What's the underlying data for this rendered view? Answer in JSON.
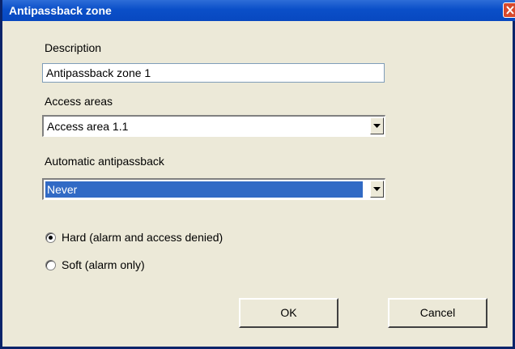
{
  "window": {
    "title": "Antipassback zone"
  },
  "description": {
    "label": "Description",
    "value": "Antipassback zone 1"
  },
  "access_areas": {
    "label": "Access areas",
    "selected": "Access area 1.1"
  },
  "automatic_antipassback": {
    "label": "Automatic antipassback",
    "selected": "Never"
  },
  "mode": {
    "options": [
      {
        "label": "Hard (alarm and access denied)",
        "checked": true
      },
      {
        "label": "Soft (alarm only)",
        "checked": false
      }
    ]
  },
  "buttons": {
    "ok": "OK",
    "cancel": "Cancel"
  },
  "colors": {
    "titlebar": "#0a4fc8",
    "selection": "#316ac5",
    "dialog_bg": "#ece9d8"
  }
}
